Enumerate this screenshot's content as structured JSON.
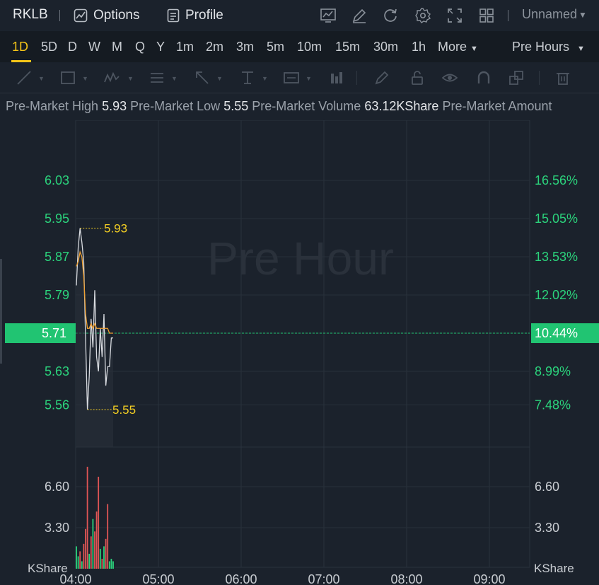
{
  "header": {
    "symbol": "RKLB",
    "options_label": "Options",
    "profile_label": "Profile",
    "layout_name": "Unnamed",
    "icons": [
      "indicator-icon",
      "draw-icon",
      "refresh-icon",
      "settings-icon",
      "fullscreen-icon",
      "grid-layout-icon"
    ]
  },
  "timeframes": {
    "items": [
      "1D",
      "5D",
      "D",
      "W",
      "M",
      "Q",
      "Y",
      "1m",
      "2m",
      "3m",
      "5m",
      "10m",
      "15m",
      "30m",
      "1h"
    ],
    "active": "1D",
    "more_label": "More",
    "session_label": "Pre Hours"
  },
  "stats": {
    "high_label": "Pre-Market High",
    "high_value": "5.93",
    "low_label": "Pre-Market Low",
    "low_value": "5.55",
    "volume_label": "Pre-Market Volume",
    "volume_value": "63.12KShare",
    "amount_label": "Pre-Market Amount"
  },
  "colors": {
    "up": "#2bd37c",
    "down": "#e05555",
    "price_line": "#d8dbe0",
    "avg_line": "#f0a030",
    "marker": "#f5d023",
    "last_price_bg": "#21c472"
  },
  "chart_data": {
    "type": "line",
    "watermark": "Pre Hour",
    "price_axis": {
      "ticks": [
        "6.03",
        "5.95",
        "5.87",
        "5.79",
        "5.71",
        "5.63",
        "5.56"
      ],
      "tick_values": [
        6.03,
        5.95,
        5.87,
        5.79,
        5.71,
        5.63,
        5.56
      ]
    },
    "percent_axis": {
      "ticks": [
        "16.56%",
        "15.05%",
        "13.53%",
        "12.02%",
        "10.44%",
        "8.99%",
        "7.48%"
      ]
    },
    "last_price": "5.71",
    "last_percent": "10.44%",
    "high_marker": "5.93",
    "low_marker": "5.55",
    "high_value": 5.93,
    "low_value": 5.55,
    "time_axis": {
      "labels": [
        "04:00",
        "05:00",
        "06:00",
        "07:00",
        "08:00",
        "09:00"
      ],
      "hours": [
        4,
        5,
        6,
        7,
        8,
        9
      ]
    },
    "volume_axis": {
      "ticks": [
        "6.60",
        "3.30"
      ],
      "tick_values": [
        6.6,
        3.3
      ],
      "unit_left": "KShare",
      "unit_right": "KShare"
    },
    "price_series": {
      "name": "",
      "minutes": [
        0,
        1,
        2,
        3,
        4,
        5,
        6,
        7,
        8,
        9,
        10,
        11,
        12,
        13,
        14,
        15,
        16,
        17,
        18,
        19,
        20,
        21,
        22,
        23,
        24,
        25,
        26,
        27,
        28,
        29,
        30
      ],
      "values": [
        5.81,
        5.89,
        5.93,
        5.9,
        5.86,
        5.7,
        5.55,
        5.62,
        5.74,
        5.68,
        5.8,
        5.66,
        5.63,
        5.72,
        5.66,
        5.75,
        5.6,
        5.64,
        5.64,
        5.7,
        5.7
      ]
    },
    "avg_series": {
      "name": "",
      "values": [
        5.85,
        5.86,
        5.88,
        5.87,
        5.83,
        5.75,
        5.72,
        5.72,
        5.73,
        5.72,
        5.73,
        5.72,
        5.72,
        5.72,
        5.72,
        5.72,
        5.72,
        5.72,
        5.71,
        5.71,
        5.71
      ]
    },
    "volume_series": {
      "values": [
        1.8,
        1.0,
        1.4,
        0.6,
        2.0,
        3.2,
        8.2,
        1.2,
        2.6,
        4.0,
        3.0,
        4.6,
        7.4,
        1.6,
        0.8,
        1.8,
        2.4,
        5.2,
        0.6,
        0.8,
        0.6
      ],
      "up": [
        true,
        true,
        false,
        true,
        false,
        false,
        false,
        true,
        false,
        true,
        false,
        false,
        false,
        true,
        false,
        true,
        false,
        false,
        true,
        true,
        true
      ]
    }
  }
}
